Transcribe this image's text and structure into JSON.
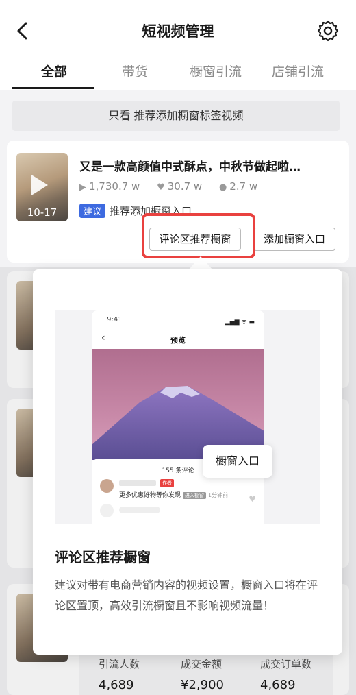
{
  "header": {
    "title": "短视频管理"
  },
  "tabs": [
    {
      "label": "全部",
      "active": true
    },
    {
      "label": "带货",
      "active": false
    },
    {
      "label": "橱窗引流",
      "active": false
    },
    {
      "label": "店铺引流",
      "active": false
    }
  ],
  "filter": {
    "label": "只看 推荐添加橱窗标签视频"
  },
  "video": {
    "title": "又是一款高颜值中式酥点，中秋节做起啦…",
    "date": "10-17",
    "plays": "1,730.7 w",
    "likes": "30.7 w",
    "comments": "2.7 w",
    "suggest_badge": "建议",
    "suggest_text": "推荐添加橱窗入口",
    "btn_comment": "评论区推荐橱窗",
    "btn_add": "添加橱窗入口"
  },
  "bottom_stats": [
    {
      "label": "引流人数",
      "value": "4,689"
    },
    {
      "label": "成交金额",
      "value": "¥2,900"
    },
    {
      "label": "成交订单数",
      "value": "4,689"
    }
  ],
  "popup": {
    "preview": {
      "time": "9:41",
      "signal": "▂▄▆ ᯤ ▬",
      "title": "预览",
      "comment_count": "155 条评论",
      "tag": "作者",
      "comment_text": "更多优惠好物等你发现",
      "entry_tag": "进入橱窗",
      "time_ago": "1分钟前",
      "callout": "橱窗入口"
    },
    "title": "评论区推荐橱窗",
    "description": "建议对带有电商营销内容的视频设置，橱窗入口将在评论区置顶，高效引流橱窗且不影响视频流量！"
  },
  "colors": {
    "accent_blue": "#3d6ae0",
    "highlight_red": "#e9413f"
  }
}
